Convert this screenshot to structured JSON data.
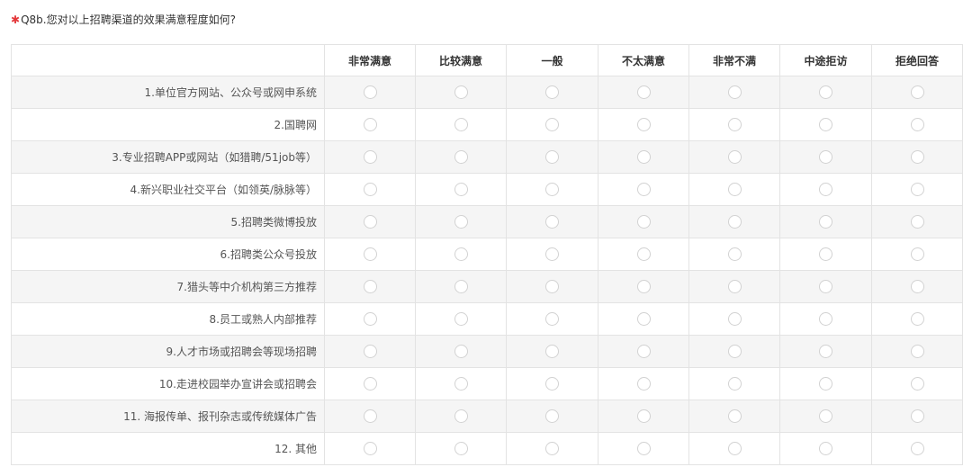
{
  "question": {
    "required_mark": "✱",
    "text": "Q8b.您对以上招聘渠道的效果满意程度如何?"
  },
  "columns": [
    "非常满意",
    "比较满意",
    "一般",
    "不太满意",
    "非常不满",
    "中途拒访",
    "拒绝回答"
  ],
  "rows": [
    "1.单位官方网站、公众号或网申系统",
    "2.国聘网",
    "3.专业招聘APP或网站（如猎聘/51job等）",
    "4.新兴职业社交平台（如领英/脉脉等）",
    "5.招聘类微博投放",
    "6.招聘类公众号投放",
    "7.猎头等中介机构第三方推荐",
    "8.员工或熟人内部推荐",
    "9.人才市场或招聘会等现场招聘",
    "10.走进校园举办宣讲会或招聘会",
    "11. 海报传单、报刊杂志或传统媒体广告",
    "12. 其他"
  ],
  "colors": {
    "required": "#e4393c",
    "border": "#e3e3e3",
    "stripe": "#f5f5f5"
  }
}
